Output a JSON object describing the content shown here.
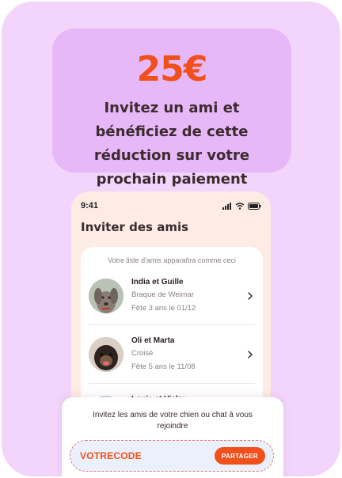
{
  "promo": {
    "amount": "25€",
    "text": "Invitez un ami et bénéficiez de cette réduction sur votre prochain paiement"
  },
  "phone": {
    "status_time": "9:41",
    "title": "Inviter des amis",
    "list_hint": "Votre liste d'amis apparaîtra comme ceci",
    "friends": [
      {
        "name": "India et Guille",
        "breed": "Braque de Weimar",
        "birthday": "Fête 3 ans le 01/12"
      },
      {
        "name": "Oli et Marta",
        "breed": "Croisé",
        "birthday": "Fête 5 ans le 11/08"
      },
      {
        "name": "Louie et Vicky",
        "breed": "",
        "birthday": ""
      }
    ]
  },
  "invite": {
    "text": "Invitez les amis de votre chien ou chat à vous rejoindre",
    "code": "VOTRECODE",
    "share_label": "PARTAGER"
  },
  "colors": {
    "accent": "#f0501c",
    "background": "#f3d5fb",
    "promo_background": "#e7b8f7"
  }
}
